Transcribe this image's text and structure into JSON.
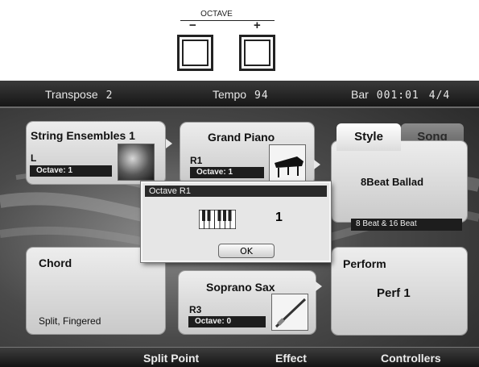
{
  "panel_diagram": {
    "octave_label": "OCTAVE",
    "minus_label": "−",
    "plus_label": "+"
  },
  "status_bar": {
    "transpose_label": "Transpose",
    "transpose_value": "2",
    "tempo_label": "Tempo",
    "tempo_value": "94",
    "bar_label": "Bar",
    "bar_value": "001:01",
    "time_signature": "4/4"
  },
  "voices": {
    "left": {
      "name": "String Ensembles 1",
      "part": "L",
      "octave": "Octave:  1",
      "image_icon": "strings-photo-icon"
    },
    "right1": {
      "name": "Grand Piano",
      "part": "R1",
      "octave": "Octave:  1",
      "image_icon": "grand-piano-photo-icon"
    },
    "right3": {
      "name": "Soprano Sax",
      "part": "R3",
      "octave": "Octave:  0",
      "image_icon": "soprano-sax-photo-icon"
    }
  },
  "chord": {
    "title": "Chord",
    "mode": "Split, Fingered"
  },
  "style_panel": {
    "tabs": [
      "Style",
      "Song"
    ],
    "active_tab": "Style",
    "style_name": "8Beat Ballad",
    "category": "8 Beat & 16 Beat"
  },
  "perform": {
    "title": "Perform",
    "value": "Perf 1"
  },
  "bottom_menu": [
    "Split Point",
    "Effect",
    "Controllers"
  ],
  "dialog": {
    "title": "Octave R1",
    "value": "1",
    "ok_label": "OK",
    "keyboard_icon": "keyboard-icon"
  },
  "colors": {
    "lcd_dark": "#262626",
    "panel_light": "#ededed",
    "label_bg": "#1d1d1d"
  }
}
